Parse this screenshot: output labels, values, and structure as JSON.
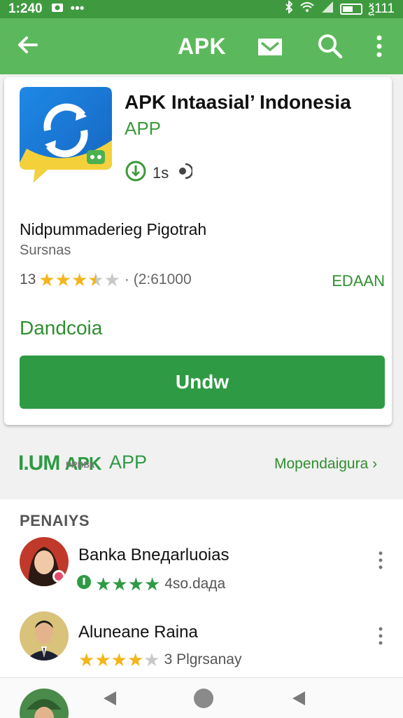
{
  "status_bar": {
    "time": "1:240",
    "right_text": "ѯ111"
  },
  "app_bar": {
    "title": "APK"
  },
  "app": {
    "name": "APK Intaasial’ Indonesia",
    "type": "APP",
    "size": "1s",
    "description_title": "Nidpummaderieg Pigotrah",
    "description_sub": "Sursnas",
    "rating_value": "13",
    "rating_stars": 3.5,
    "rating_count": "· (2:61000",
    "edaan_link": "EDAAN",
    "download_label": "Dandcoia",
    "install_button": "Undw"
  },
  "promo": {
    "logo": "I.UM",
    "logo_apk": "APK",
    "logo_sub": "PRBBit",
    "app": "APP",
    "link": "Mopendaigura ›"
  },
  "reviews": {
    "heading": "PENAIYS",
    "items": [
      {
        "name": "Banka Bneдarluoias",
        "stars": 5,
        "meta": "4so.daда"
      },
      {
        "name": "Aluneane Raina",
        "stars": 4,
        "meta": "3 Plgrsanay"
      }
    ]
  },
  "colors": {
    "brand_green": "#5cb85c",
    "dark_green": "#2e9a44",
    "star": "#f3b51b"
  }
}
